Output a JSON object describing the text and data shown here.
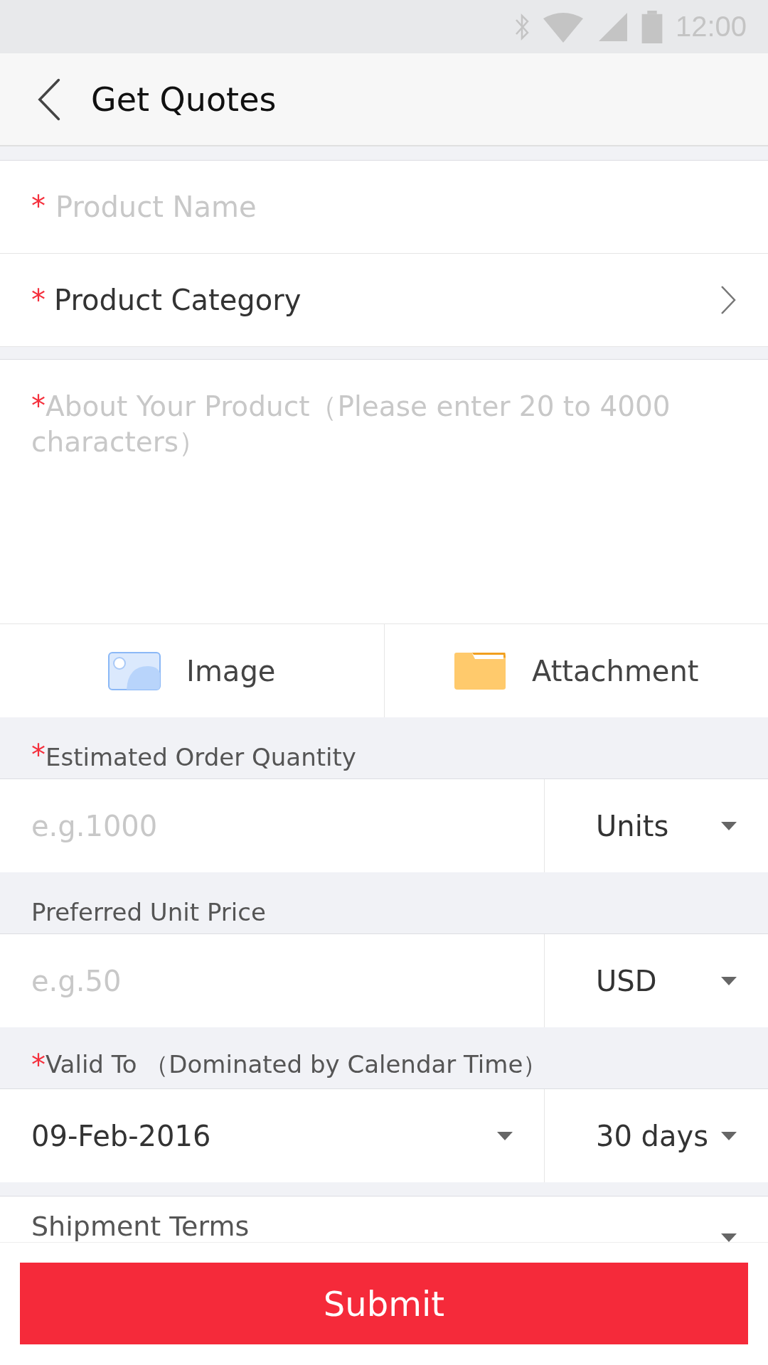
{
  "status_bar": {
    "time": "12:00"
  },
  "header": {
    "title": "Get Quotes"
  },
  "product_name": {
    "mark": "*",
    "placeholder": "Product Name"
  },
  "product_category": {
    "mark": "*",
    "label": "Product Category"
  },
  "about": {
    "mark": "*",
    "placeholder": "About Your Product（Please enter 20 to 4000 characters）"
  },
  "uploads": [
    {
      "kind": "image",
      "label": "Image"
    },
    {
      "kind": "folder",
      "label": "Attachment"
    }
  ],
  "sections": [
    {
      "mark": "*",
      "label": "Estimated Order Quantity",
      "kind": "input",
      "placeholder": "e.g.1000",
      "unit": "Units"
    },
    {
      "label": "Preferred Unit Price",
      "kind": "input",
      "placeholder": "e.g.50",
      "unit": "USD"
    },
    {
      "mark": "*",
      "label": "Valid To （Dominated by Calendar Time）",
      "kind": "date",
      "value": "09-Feb-2016",
      "unit": "30 days"
    }
  ],
  "shipment": {
    "label": "Shipment Terms"
  },
  "submit": "Submit"
}
